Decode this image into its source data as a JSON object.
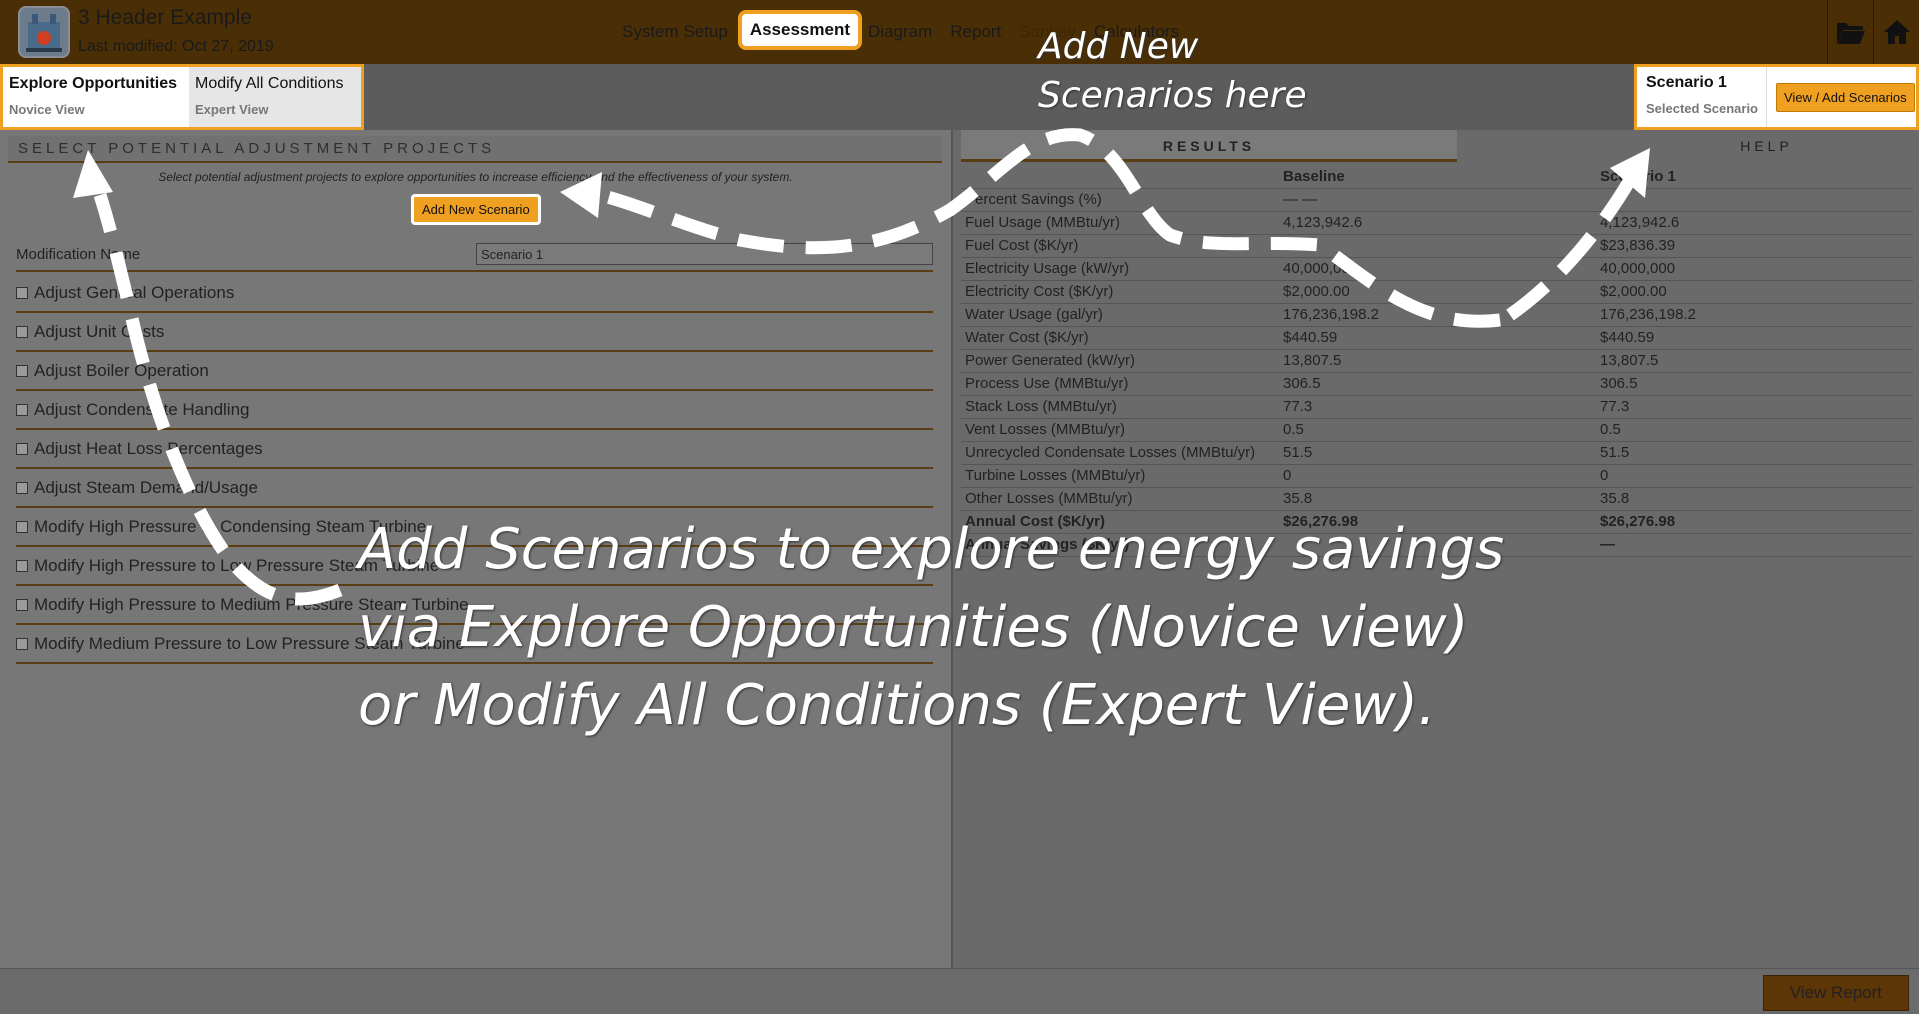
{
  "header": {
    "title": "3 Header Example",
    "last_modified": "Last modified: Oct 27, 2019",
    "nav": [
      "System Setup",
      "Assessment",
      "Diagram",
      "Report",
      "Sankey",
      "Calculators"
    ],
    "icons": [
      "folder-icon",
      "home-icon"
    ]
  },
  "view_tabs": {
    "explore": {
      "title": "Explore Opportunities",
      "sub": "Novice View"
    },
    "modify": {
      "title": "Modify All Conditions",
      "sub": "Expert View"
    }
  },
  "scenario_box": {
    "name": "Scenario 1",
    "sub": "Selected Scenario",
    "button": "View / Add Scenarios"
  },
  "left": {
    "section_title": "SELECT POTENTIAL ADJUSTMENT PROJECTS",
    "help_text": "Select potential adjustment projects to explore opportunities to increase efficiency and the effectiveness of your system.",
    "add_button": "Add New Scenario",
    "mod_name_label": "Modification Name",
    "mod_name_value": "Scenario 1",
    "opportunities": [
      "Adjust General Operations",
      "Adjust Unit Costs",
      "Adjust Boiler Operation",
      "Adjust Condensate Handling",
      "Adjust Heat Loss Percentages",
      "Adjust Steam Demand/Usage",
      "Modify High Pressure to Condensing Steam Turbine",
      "Modify High Pressure to Low Pressure Steam Turbine",
      "Modify High Pressure to Medium Pressure Steam Turbine",
      "Modify Medium Pressure to Low Pressure Steam Turbine"
    ]
  },
  "right": {
    "tabs": [
      "RESULTS",
      "HELP"
    ],
    "columns": [
      "",
      "Baseline",
      "Scenario 1"
    ],
    "rows": [
      [
        "Percent Savings (%)",
        "— —",
        ""
      ],
      [
        "Fuel Usage (MMBtu/yr)",
        "4,123,942.6",
        "4,123,942.6"
      ],
      [
        "Fuel Cost ($K/yr)",
        "",
        "$23,836.39"
      ],
      [
        "Electricity Usage (kW/yr)",
        "40,000,000",
        "40,000,000"
      ],
      [
        "Electricity Cost ($K/yr)",
        "$2,000.00",
        "$2,000.00"
      ],
      [
        "Water Usage (gal/yr)",
        "176,236,198.2",
        "176,236,198.2"
      ],
      [
        "Water Cost ($K/yr)",
        "$440.59",
        "$440.59"
      ],
      [
        "Power Generated (kW/yr)",
        "13,807.5",
        "13,807.5"
      ],
      [
        "Process Use (MMBtu/yr)",
        "306.5",
        "306.5"
      ],
      [
        "Stack Loss (MMBtu/yr)",
        "77.3",
        "77.3"
      ],
      [
        "Vent Losses (MMBtu/yr)",
        "0.5",
        "0.5"
      ],
      [
        "Unrecycled Condensate Losses (MMBtu/yr)",
        "51.5",
        "51.5"
      ],
      [
        "Turbine Losses (MMBtu/yr)",
        "0",
        "0"
      ],
      [
        "Other Losses (MMBtu/yr)",
        "35.8",
        "35.8"
      ],
      [
        "Annual Cost ($K/yr)",
        "$26,276.98",
        "$26,276.98"
      ],
      [
        "Annual Savings ($K/yr)",
        "",
        "—"
      ]
    ]
  },
  "footer": {
    "report_button": "View Report"
  },
  "annotations": {
    "top_line1": "Add New",
    "top_line2": "Scenarios here",
    "main_line1": "Add Scenarios to explore energy savings",
    "main_line2": "via Explore Opportunities (Novice view)",
    "main_line3": "or Modify All Conditions (Expert View)."
  }
}
